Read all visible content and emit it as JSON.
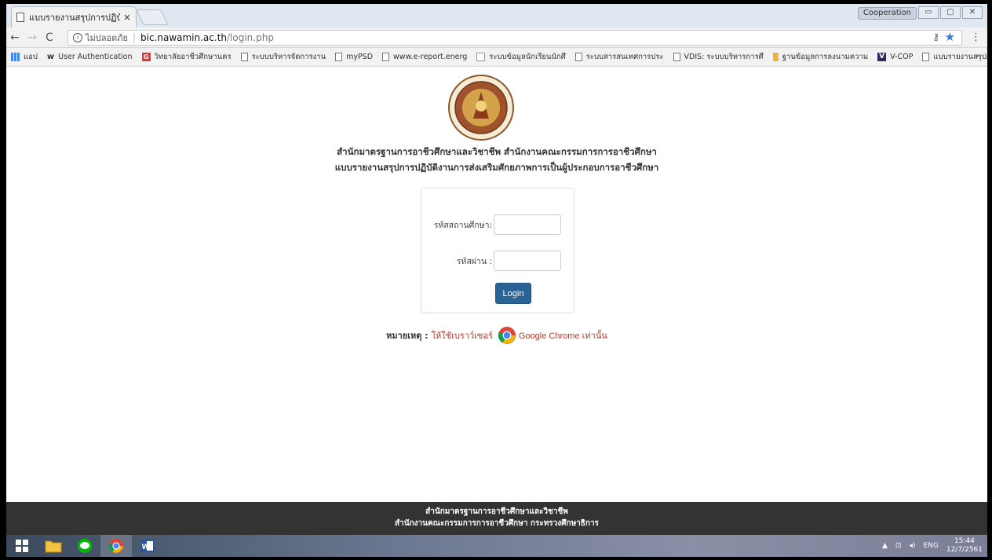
{
  "browser": {
    "tab_title": "แบบรายงานสรุปการปฏิบัติงาน",
    "tab_close": "×",
    "profile": "Cooperation",
    "window_buttons": [
      "▭",
      "▢",
      "✕"
    ],
    "back": "←",
    "forward": "→",
    "reload": "C",
    "secure_text": "ไม่ปลอดภัย",
    "url_host": "bic.nawamin.ac.th",
    "url_path": "/login.php",
    "menu": "⋮"
  },
  "bookmarks": {
    "items": [
      "แอป",
      "User Authentication",
      "วิทยาลัยอาชีวศึกษานคร",
      "ระบบบริหารจัดการงาน",
      "myPSD",
      "www.e-report.energ",
      "ระบบข้อมูลนักเรียนนักศึ",
      "ระบบสารสนเทศการประ",
      "VDIS: ระบบบริหารการศึ",
      "ฐานข้อมูลการลงนามความ",
      "V-COP",
      "แบบรายงานสรุปการปฏิ"
    ],
    "more": "»"
  },
  "page": {
    "heading1": "สำนักมาตรฐานการอาชีวศึกษาและวิชาชีพ สำนักงานคณะกรรมการการอาชีวศึกษา",
    "heading2": "แบบรายงานสรุปการปฏิบัติงานการส่งเสริมศักยภาพการเป็นผู้ประกอบการอาชีวศึกษา",
    "login": {
      "school_code_label": "รหัสสถานศึกษา:",
      "password_label": "รหัสผ่าน :",
      "school_code_value": "",
      "password_value": "",
      "button": "Login"
    },
    "note_label": "หมายเหตุ :",
    "note_text": "ให้ใช้เบราว์เซอร์",
    "note_browser": "Google Chrome เท่านั้น"
  },
  "footer": {
    "line1": "สำนักมาตรฐานการอาชีวศึกษาและวิชาชีพ",
    "line2": "สำนักงานคณะกรรมการการอาชีวศึกษา กระทรวงศึกษาธิการ"
  },
  "taskbar": {
    "lang": "ENG",
    "time": "15:44",
    "date": "12/7/2561"
  },
  "colors": {
    "login_button": "#2a6496",
    "note_red": "#c0392b",
    "footer_bg": "#333333"
  }
}
